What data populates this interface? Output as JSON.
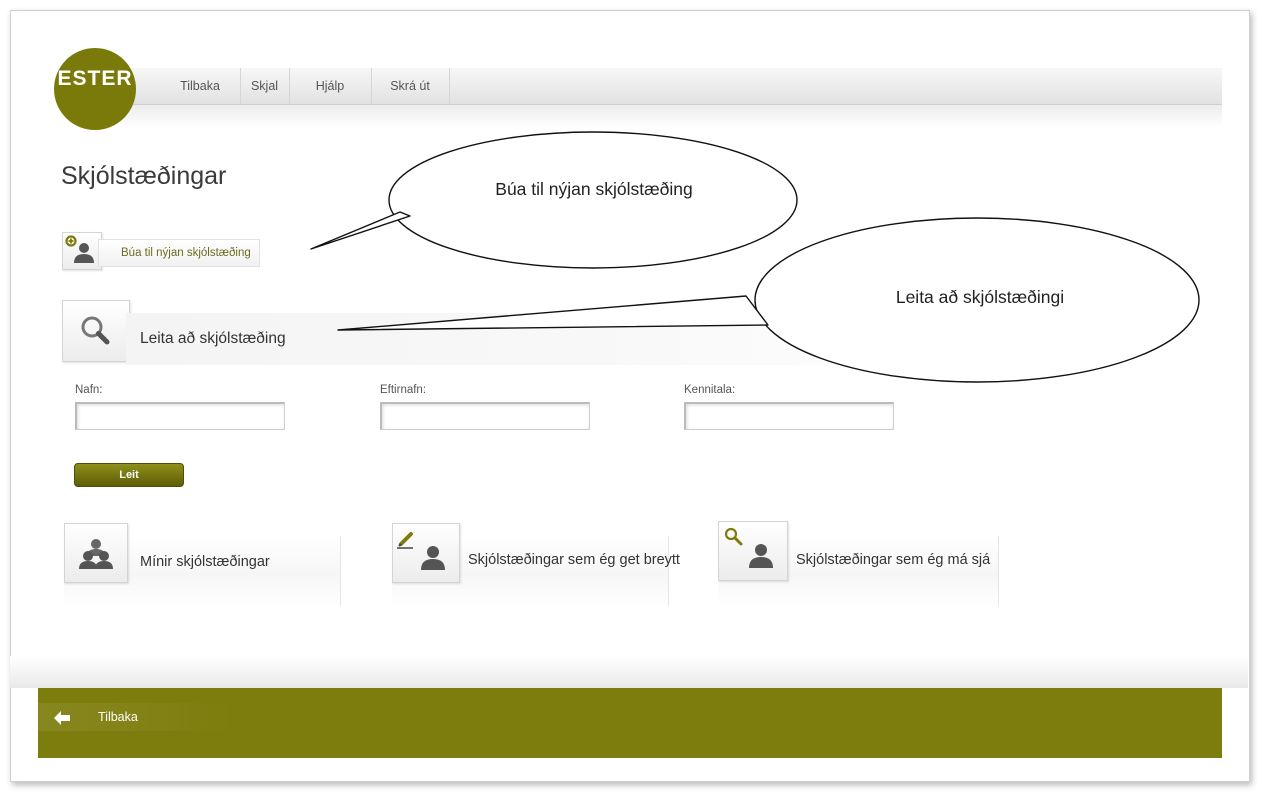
{
  "logo": {
    "text": "ESTER"
  },
  "nav": {
    "items": [
      {
        "label": "Tilbaka"
      },
      {
        "label": "Skjal"
      },
      {
        "label": "Hjálp"
      },
      {
        "label": "Skrá út"
      }
    ]
  },
  "page": {
    "title": "Skjólstæðingar"
  },
  "create": {
    "label": "Búa til nýjan skjólstæðing",
    "icon": "add-user-icon"
  },
  "search": {
    "label": "Leita að skjólstæðing",
    "icon": "magnifier-icon",
    "fields": [
      {
        "label": "Nafn:",
        "value": ""
      },
      {
        "label": "Eftirnafn:",
        "value": ""
      },
      {
        "label": "Kennitala:",
        "value": ""
      }
    ],
    "button_label": "Leit"
  },
  "cards": [
    {
      "label": "Mínir skjólstæðingar",
      "icon": "users-icon"
    },
    {
      "label": "Skjólstæðingar sem ég get breytt",
      "icon": "edit-user-icon"
    },
    {
      "label": "Skjólstæðingar sem ég má sjá",
      "icon": "search-user-icon"
    }
  ],
  "callouts": {
    "create": "Búa til nýjan skjólstæðing",
    "search": "Leita að skjólstæðingi"
  },
  "footer": {
    "back_label": "Tilbaka",
    "icon": "arrow-left-icon"
  },
  "colors": {
    "brand": "#7d7d0d",
    "button": "#6b6b0f"
  }
}
